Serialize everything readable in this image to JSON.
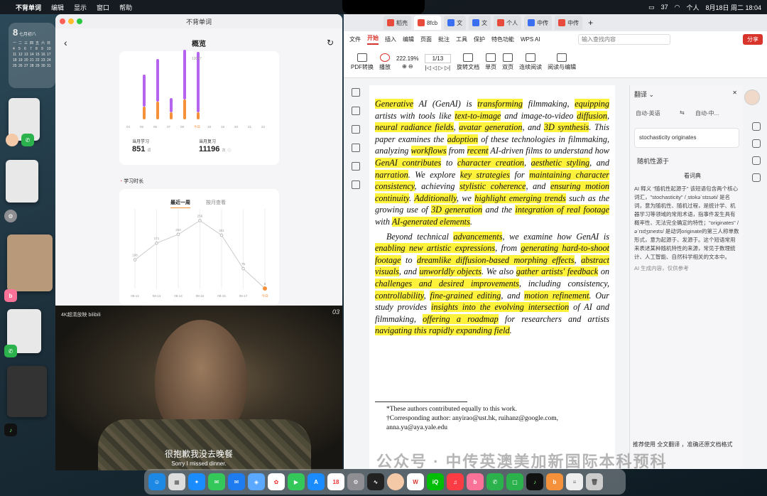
{
  "menubar": {
    "app_name": "不背单词",
    "items": [
      "编辑",
      "显示",
      "窗口",
      "帮助"
    ],
    "status_items": [
      "37",
      "个人",
      "8月18日 周二 18:04"
    ]
  },
  "calendar_widget": {
    "month": "七月初八",
    "day": "8",
    "weekdays": [
      "一",
      "二",
      "三",
      "四",
      "五",
      "六",
      "日"
    ],
    "dates": [
      "4",
      "5",
      "6",
      "7",
      "8",
      "9",
      "10",
      "11",
      "12",
      "13",
      "14",
      "15",
      "16",
      "17",
      "18",
      "19",
      "20",
      "21",
      "22",
      "23",
      "24",
      "25",
      "26",
      "27",
      "28",
      "29",
      "30",
      "31"
    ]
  },
  "vocab": {
    "window_title": "不背单词",
    "page_title": "概览",
    "peak_label": "13047",
    "bar_labels": [
      "04",
      "05",
      "06",
      "07",
      "08",
      "今日",
      "18",
      "19",
      "20",
      "21",
      "22"
    ],
    "stat1_label": "当月学习",
    "stat1_value": "851",
    "stat1_unit": "词",
    "stat2_label": "当月复习",
    "stat2_value": "11196",
    "stat2_unit": "次",
    "section_title": "学习时长",
    "tab_week": "最近一周",
    "tab_month": "按月查看",
    "chart_data": {
      "type": "line",
      "x": [
        "08-12",
        "08-13",
        "08-14",
        "08-15",
        "08-16",
        "08-17",
        "今日"
      ],
      "values": [
        108,
        171,
        204,
        256,
        201,
        75,
        0
      ],
      "ylim": [
        0,
        300
      ]
    }
  },
  "video": {
    "brand": "4K超清放映 bilibili",
    "episode": "03",
    "subtitle_cn": "很抱歉我没去晚餐",
    "subtitle_en": "Sorry I missed dinner."
  },
  "wps": {
    "tabs": [
      "稻壳",
      "8fcb",
      "文",
      "文",
      "个人",
      "中传",
      "中传"
    ],
    "menu": [
      "文件",
      "开始",
      "插入",
      "编辑",
      "页面",
      "批注",
      "工具",
      "保护",
      "特色功能",
      "WPS AI"
    ],
    "search_placeholder": "输入查找内容",
    "share": "分享",
    "tools": [
      "PDF转换",
      "播放",
      "222.19%",
      "1/13",
      "旋转文档",
      "单页",
      "双页",
      "连续阅读",
      "阅读与编辑"
    ],
    "doc_para1": [
      {
        "t": "Generative",
        "h": true
      },
      {
        "t": " AI (GenAI) is "
      },
      {
        "t": "transforming",
        "h": true
      },
      {
        "t": " filmmaking, "
      },
      {
        "t": "equipping",
        "h": true
      },
      {
        "t": " artists with tools like "
      },
      {
        "t": "text-to-image",
        "h": true
      },
      {
        "t": " and image-to-video "
      },
      {
        "t": "diffusion",
        "h": true
      },
      {
        "t": ", "
      },
      {
        "t": "neural radiance fields",
        "h": true
      },
      {
        "t": ", "
      },
      {
        "t": "avatar generation",
        "h": true
      },
      {
        "t": ", and "
      },
      {
        "t": "3D synthesis",
        "h": true
      },
      {
        "t": ".  This paper examines the "
      },
      {
        "t": "adoption",
        "h": true
      },
      {
        "t": " of these technologies in filmmaking, analyzing "
      },
      {
        "t": "workflows",
        "h": true
      },
      {
        "t": " from "
      },
      {
        "t": "recent",
        "h": true
      },
      {
        "t": " AI-driven films to understand how "
      },
      {
        "t": "GenAI contributes",
        "h": true
      },
      {
        "t": " to "
      },
      {
        "t": "character creation",
        "h": true
      },
      {
        "t": ", "
      },
      {
        "t": "aesthetic styling",
        "h": true
      },
      {
        "t": ", and "
      },
      {
        "t": "narration",
        "h": true
      },
      {
        "t": ". We explore "
      },
      {
        "t": "key strategies",
        "h": true
      },
      {
        "t": " for "
      },
      {
        "t": "maintaining character consistency",
        "h": true
      },
      {
        "t": ", achieving "
      },
      {
        "t": "stylistic coherence",
        "h": true
      },
      {
        "t": ", and "
      },
      {
        "t": "ensuring motion continuity",
        "h": true
      },
      {
        "t": ". "
      },
      {
        "t": "Additionally",
        "h": true
      },
      {
        "t": ", we "
      },
      {
        "t": "highlight emerging trends",
        "h": true
      },
      {
        "t": " such as the growing use of "
      },
      {
        "t": "3D generation",
        "h": true
      },
      {
        "t": " and the "
      },
      {
        "t": "integration of real footage",
        "h": true
      },
      {
        "t": " with "
      },
      {
        "t": "AI-generated elements",
        "h": true
      },
      {
        "t": "."
      }
    ],
    "doc_para2": [
      {
        "t": "Beyond technical "
      },
      {
        "t": "advancements",
        "h": true
      },
      {
        "t": ", we examine how GenAI is "
      },
      {
        "t": "enabling new artistic expressions",
        "h": true
      },
      {
        "t": ", from "
      },
      {
        "t": "generating hard-to-shoot footage",
        "h": true
      },
      {
        "t": " to "
      },
      {
        "t": "dreamlike diffusion-based morphing effects",
        "h": true
      },
      {
        "t": ",  "
      },
      {
        "t": "abstract visuals",
        "h": true
      },
      {
        "t": ",  and  "
      },
      {
        "t": "unworldly objects",
        "h": true
      },
      {
        "t": ".   We also "
      },
      {
        "t": "gather artists' feedback",
        "h": true
      },
      {
        "t": " on "
      },
      {
        "t": "challenges and desired improvements",
        "h": true
      },
      {
        "t": ", including consistency, "
      },
      {
        "t": "controllability",
        "h": true
      },
      {
        "t": ", "
      },
      {
        "t": "fine-grained editing",
        "h": true
      },
      {
        "t": ", and "
      },
      {
        "t": "motion refinement",
        "h": true
      },
      {
        "t": ". Our study provides "
      },
      {
        "t": "insights into the evolving intersection",
        "h": true
      },
      {
        "t": " of AI and filmmaking, "
      },
      {
        "t": "offering a roadmap",
        "h": true
      },
      {
        "t": " for researchers and artists "
      },
      {
        "t": "navigating this rapidly expanding field",
        "h": true
      },
      {
        "t": "."
      }
    ],
    "footnote1": "*These authors contributed equally to this work.",
    "footnote2": "†Corresponding   author:   anyirao@ust.hk,   ruihanz@google.com, anna.yu@aya.yale.edu",
    "translate": {
      "header": "翻译",
      "lang_from": "自动-英语",
      "lang_to": "自动-中...",
      "query": "stochasticity originates",
      "result": "随机性源于",
      "dict_btn": "看词典",
      "explain": "AI 释义 \"随机性起源于\" 该短语包含两个核心词汇，\"stochasticity\" /ˌstokəˈstɪsəti/ 是名词，意为随机性、随机过程，是统计学、机器学习等领域的常用术语，指事件发生具有概率性、无法完全确定的特性；\"originates\" /əˈrɪdʒɪneɪts/ 是动词originate的第三人称单数形式，意为起源于、发源于。这个短语常用来表述某种随机特性的来源，常见于数理统计、人工智能、自然科学相关的文本中。",
      "disclaimer": "AI 生成内容，仅供参考",
      "footer": "推荐使用 全文翻译 ，准确还原文档格式"
    },
    "watermark": "公众号 · 中传英澳美加新国际本科预科"
  },
  "colors": {
    "wps_red": "#d9342b",
    "highlight": "#fff23a",
    "bar_purple": "#b564f0",
    "bar_orange": "#f5913a"
  }
}
